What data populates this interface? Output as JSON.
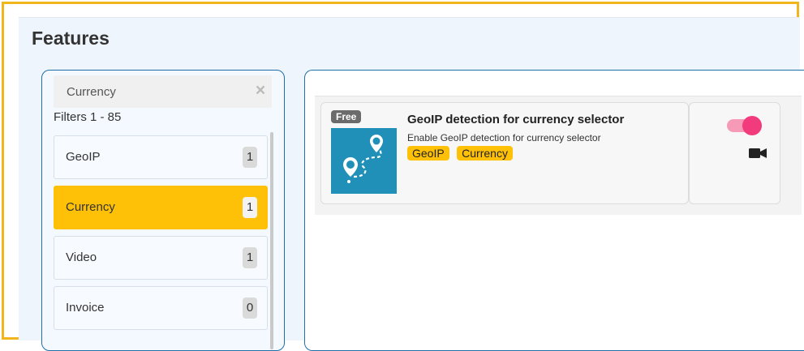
{
  "page": {
    "title": "Features"
  },
  "filters": {
    "search": {
      "value": "Currency",
      "clear_icon": "×"
    },
    "count_text": "Filters 1 - 85",
    "items": [
      {
        "label": "GeoIP",
        "count": "1",
        "active": false
      },
      {
        "label": "Currency",
        "count": "1",
        "active": true
      },
      {
        "label": "Video",
        "count": "1",
        "active": false
      },
      {
        "label": "Invoice",
        "count": "0",
        "active": false
      }
    ]
  },
  "results": {
    "card": {
      "badge": "Free",
      "title": "GeoIP detection for currency selector",
      "description": "Enable GeoIP detection for currency selector",
      "tags": [
        "GeoIP",
        "Currency"
      ],
      "image_icon": "geoip-currency-map-icon",
      "toggle_on": true,
      "video_icon": "video-camera-icon"
    }
  },
  "colors": {
    "frame": "#f2b51c",
    "accent_yellow": "#ffc107",
    "panel_border": "#1f6fa8",
    "toggle_track": "#f79ab7",
    "toggle_knob": "#f23b7c",
    "image_bg": "#2090b8"
  }
}
